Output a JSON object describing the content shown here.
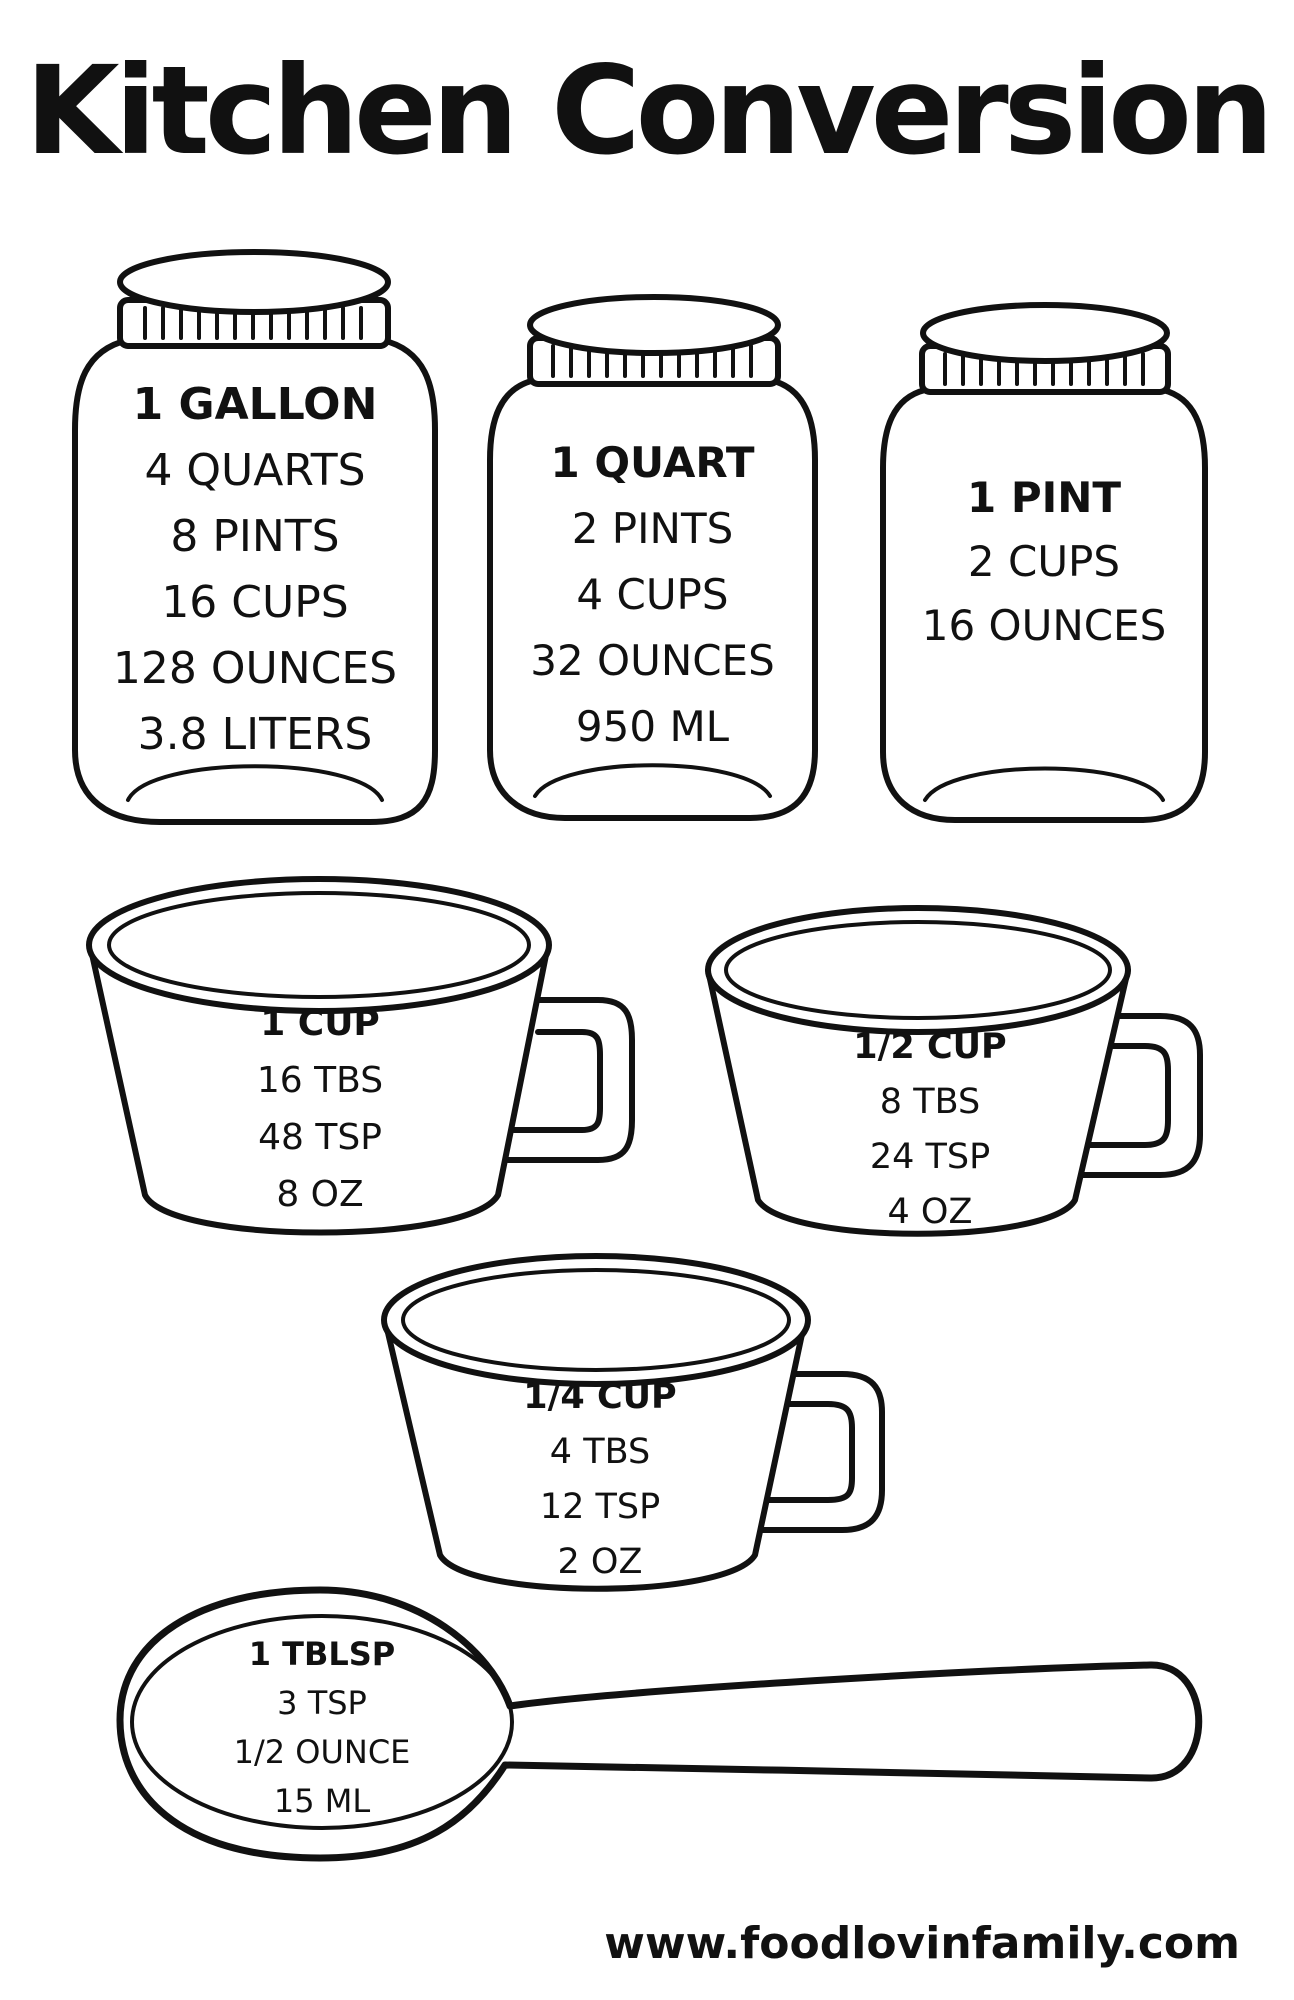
{
  "title": "Kitchen Conversion",
  "jars": [
    {
      "heading": "1 GALLON",
      "lines": [
        "4 QUARTS",
        "8 PINTS",
        "16 CUPS",
        "128 OUNCES",
        "3.8 LITERS"
      ]
    },
    {
      "heading": "1 QUART",
      "lines": [
        "2 PINTS",
        "4 CUPS",
        "32 OUNCES",
        "950 ML"
      ]
    },
    {
      "heading": "1 PINT",
      "lines": [
        "2 CUPS",
        "16 OUNCES"
      ]
    }
  ],
  "cups": [
    {
      "heading": "1 CUP",
      "lines": [
        "16 TBS",
        "48 TSP",
        "8 OZ"
      ]
    },
    {
      "heading": "1/2 CUP",
      "lines": [
        "8 TBS",
        "24 TSP",
        "4 OZ"
      ]
    },
    {
      "heading": "1/4 CUP",
      "lines": [
        "4 TBS",
        "12 TSP",
        "2 OZ"
      ]
    }
  ],
  "spoon": {
    "heading": "1 TBLSP",
    "lines": [
      "3 TSP",
      "1/2 OUNCE",
      "15 ML"
    ]
  },
  "website": "www.foodlovinfamily.com"
}
